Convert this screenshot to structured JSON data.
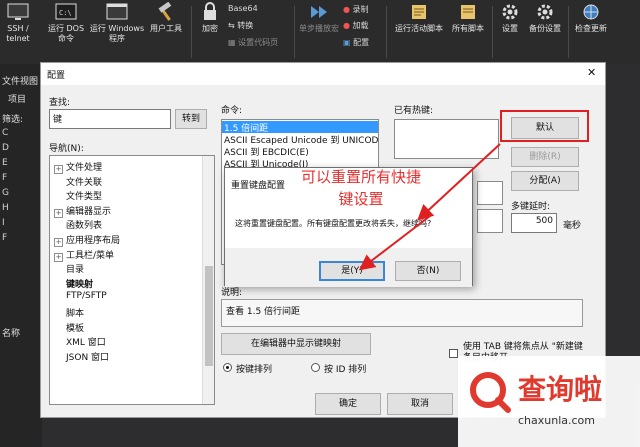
{
  "ribbon": {
    "ssh_telnet": "SSH /\ntelnet",
    "run_dos": "运行 DOS\n命令",
    "run_windows": "运行 Windows\n程序",
    "user_tools": "用户工具",
    "encrypt": "加密",
    "base64": "Base64",
    "convert": "转换",
    "set_charset": "设置代码页",
    "single_step": "单步播放宏",
    "record": "录制",
    "load": "加载",
    "config": "配置",
    "run_active_script": "运行活动脚本",
    "all_scripts": "所有脚本",
    "settings": "设置",
    "backup_settings": "备份设置",
    "check_update": "检查更新"
  },
  "left_panel": {
    "file_view": "文件视图",
    "project": "项目",
    "filter": "筛选:",
    "name_header": "名称",
    "nodes": [
      "C",
      "D",
      "E",
      "F",
      "G",
      "H",
      "I",
      "F"
    ]
  },
  "dialog": {
    "title": "配置",
    "search_label": "查找:",
    "search_value": "键",
    "goto_button": "转到",
    "nav_label": "导航(N):",
    "tree": [
      {
        "label": "文件处理",
        "expander": "+",
        "bold": false
      },
      {
        "label": "文件关联",
        "expander": "",
        "bold": false
      },
      {
        "label": "文件类型",
        "expander": "",
        "bold": false
      },
      {
        "label": "编辑器显示",
        "expander": "+",
        "bold": false
      },
      {
        "label": "函数列表",
        "expander": "",
        "bold": false
      },
      {
        "label": "应用程序布局",
        "expander": "+",
        "bold": false
      },
      {
        "label": "工具栏/菜单",
        "expander": "+",
        "bold": false
      },
      {
        "label": "目录",
        "expander": "",
        "bold": false
      },
      {
        "label": "键映射",
        "expander": "",
        "bold": true
      },
      {
        "label": "FTP/SFTP",
        "expander": "",
        "bold": false
      },
      {
        "label": "脚本",
        "expander": "",
        "bold": false
      },
      {
        "label": "模板",
        "expander": "",
        "bold": false
      },
      {
        "label": "XML 窗口",
        "expander": "",
        "bold": false
      },
      {
        "label": "JSON 窗口",
        "expander": "",
        "bold": false
      }
    ],
    "command_label": "命令:",
    "commands": [
      {
        "label": "1.5 倍间距",
        "selected": true
      },
      {
        "label": "ASCII Escaped Unicode 到 UNICOD",
        "selected": false
      },
      {
        "label": "ASCII 到 EBCDIC(E)",
        "selected": false
      },
      {
        "label": "ASCII 到 Unicode(I)",
        "selected": false
      },
      {
        "label": "A",
        "selected": false
      },
      {
        "label": "A",
        "selected": false
      },
      {
        "label": "C",
        "selected": false
      },
      {
        "label": "C",
        "selected": false
      },
      {
        "label": "C",
        "selected": false
      },
      {
        "label": "C",
        "selected": false
      },
      {
        "label": "C",
        "selected": false
      },
      {
        "label": "C",
        "selected": false
      }
    ],
    "existing_hotkeys_label": "已有热键:",
    "default_button": "默认",
    "delete_button": "删除(R)",
    "assign_button": "分配(A)",
    "multikey_delay_label": "多键延时:",
    "delay_value": "500",
    "ms_label": "毫秒",
    "desc_label": "说明:",
    "desc_text": "查看 1.5 倍行间距",
    "show_in_editor_button": "在编辑器中显示键映射",
    "sort_by_key": "按键排列",
    "sort_by_id": "按 ID 排列",
    "tab_focus_text": "使用 TAB 键将焦点从 \"新建键\n条目中移开",
    "ok_button": "确定",
    "cancel_button": "取消"
  },
  "confirm": {
    "title": "重置键盘配置",
    "message": "这将重置键盘配置。所有键盘配置更改将丢失，继续吗?",
    "yes_button": "是(Y)",
    "no_button": "否(N)"
  },
  "annotation": {
    "text": "可以重置所有快捷键设置",
    "color": "#e83030"
  },
  "watermark": {
    "brand": "查询啦",
    "url": "chaxunla.com",
    "color": "#e03a2f"
  }
}
